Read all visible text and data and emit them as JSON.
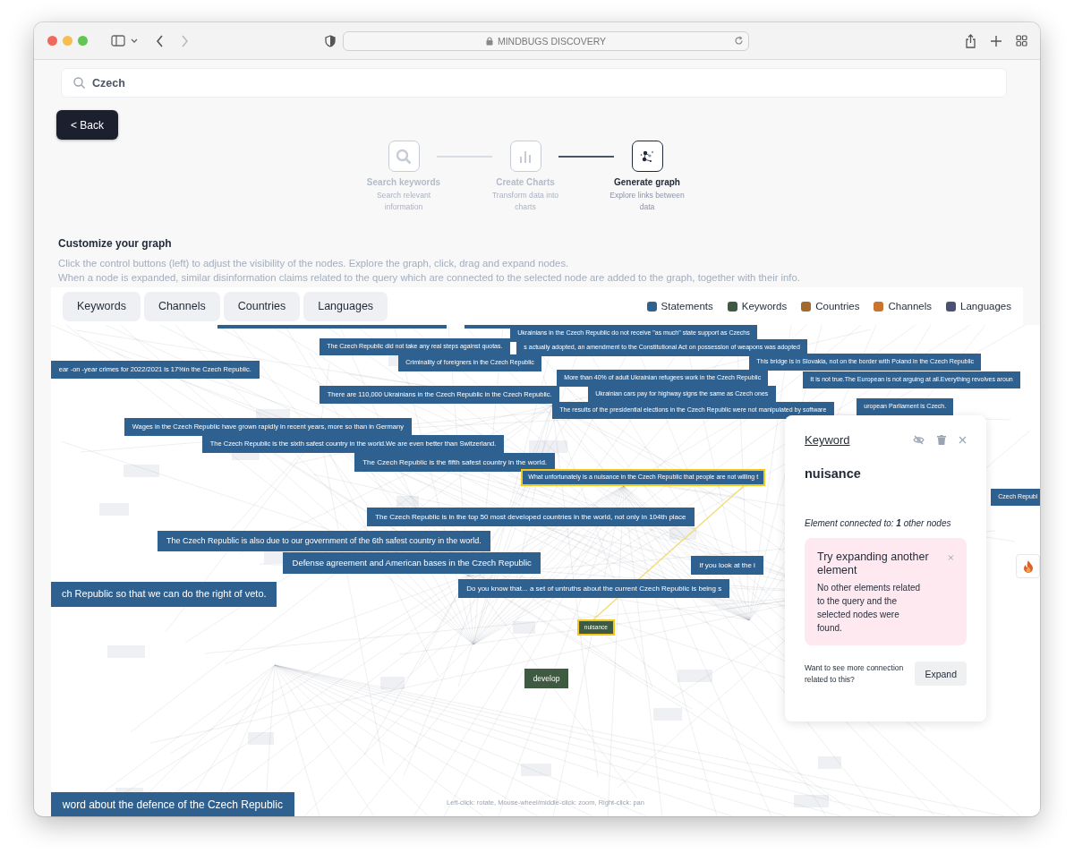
{
  "browser": {
    "address": "MINDBUGS DISCOVERY"
  },
  "search": {
    "value": "Czech"
  },
  "back_button": "< Back",
  "steps": [
    {
      "title": "Search keywords",
      "subtitle": "Search relevant information",
      "active": false
    },
    {
      "title": "Create Charts",
      "subtitle": "Transform data into charts",
      "active": false
    },
    {
      "title": "Generate graph",
      "subtitle": "Explore links between data",
      "active": true
    }
  ],
  "customize": {
    "title": "Customize your graph",
    "lines": [
      "Click the control buttons (left) to adjust the visibility of the nodes. Explore the graph, click, drag and expand nodes.",
      "When a node is expanded, similar disinformation claims related to the query which are connected to the selected node are added to the graph, together with their info."
    ]
  },
  "filters": [
    "Keywords",
    "Channels",
    "Countries",
    "Languages"
  ],
  "legend": [
    {
      "label": "Statements",
      "color": "#2f6190"
    },
    {
      "label": "Keywords",
      "color": "#3e5a40"
    },
    {
      "label": "Countries",
      "color": "#a2682c"
    },
    {
      "label": "Channels",
      "color": "#c9742f"
    },
    {
      "label": "Languages",
      "color": "#4a5172"
    }
  ],
  "graph": {
    "nodes": [
      {
        "kind": "statement",
        "label": "Ukrainians in the Czech Republic do not receive \"as much\" state support as Czechs",
        "selected": false
      },
      {
        "kind": "statement",
        "label": "The Czech Republic did not take any real steps against quotas.",
        "selected": false
      },
      {
        "kind": "statement",
        "label": "s actually adopted, an amendment to the Constitutional Act on possession of weapons was adopted",
        "selected": false
      },
      {
        "kind": "statement",
        "label": "Criminality of foreigners in the Czech Republic",
        "selected": false
      },
      {
        "kind": "statement",
        "label": "This bridge is in Slovakia, not on the border with Poland in the Czech Republic",
        "selected": false
      },
      {
        "kind": "statement",
        "label": "ear -on -year crimes for 2022/2021 is 17%in the Czech Republic.",
        "selected": false
      },
      {
        "kind": "statement",
        "label": "More than 40% of adult Ukrainian refugees work in the Czech Republic",
        "selected": false
      },
      {
        "kind": "statement",
        "label": "It is not true.The European is not arguing at all.Everything revolves aroun",
        "selected": false
      },
      {
        "kind": "statement",
        "label": "There are 110,000 Ukrainians in the Czech Republic in the Czech Republic.",
        "selected": false
      },
      {
        "kind": "statement",
        "label": "Ukrainian cars pay for highway signs the same as Czech ones",
        "selected": false
      },
      {
        "kind": "statement",
        "label": "The results of the presidential elections in the Czech Republic were not manipulated by software",
        "selected": false
      },
      {
        "kind": "statement",
        "label": "uropean Parliament is Czech.",
        "selected": false
      },
      {
        "kind": "statement",
        "label": "Wages in the Czech Republic have grown rapidly in recent years, more so than in Germany",
        "selected": false
      },
      {
        "kind": "statement",
        "label": "The Czech Republic is the sixth safest country in the world.We are even better than Switzerland.",
        "selected": false
      },
      {
        "kind": "statement",
        "label": "The Czech Republic is the fifth safest country in the world.",
        "selected": false
      },
      {
        "kind": "statement",
        "label": "What unfortunately is a nuisance in the Czech Republic that people are not willing t",
        "selected": true
      },
      {
        "kind": "statement",
        "label": "Czech Republ",
        "selected": false
      },
      {
        "kind": "statement",
        "label": "The Czech Republic is in the top 50 most developed countries in the world, not only in 104th place",
        "selected": false
      },
      {
        "kind": "statement",
        "label": "The Czech Republic is also due to our government of the 6th safest country in the world.",
        "selected": false
      },
      {
        "kind": "statement",
        "label": "Defense agreement and American bases in the Czech Republic",
        "selected": false
      },
      {
        "kind": "statement",
        "label": "If you look at the i",
        "selected": false
      },
      {
        "kind": "statement",
        "label": "ch Republic so that we can do the right of veto.",
        "selected": false
      },
      {
        "kind": "statement",
        "label": "Do you know that... a set of untruths about the current Czech Republic is being s",
        "selected": false
      },
      {
        "kind": "keyword",
        "label": "nuisance",
        "selected": true
      },
      {
        "kind": "keyword",
        "label": "develop",
        "selected": false
      },
      {
        "kind": "statement",
        "label": "word about the defence of the Czech Republic",
        "selected": false
      }
    ],
    "hint": "Left-click: rotate, Mouse-wheel/middle-click: zoom, Right-click: pan"
  },
  "panel": {
    "title": "Keyword",
    "name": "nuisance",
    "connections": "Element connected to: **1** other nodes",
    "notice": {
      "title": "Try expanding another element",
      "text": "No other elements related to the query and the selected nodes were found."
    },
    "prompt": "Want to see more connection related to this?",
    "button": "Expand"
  }
}
